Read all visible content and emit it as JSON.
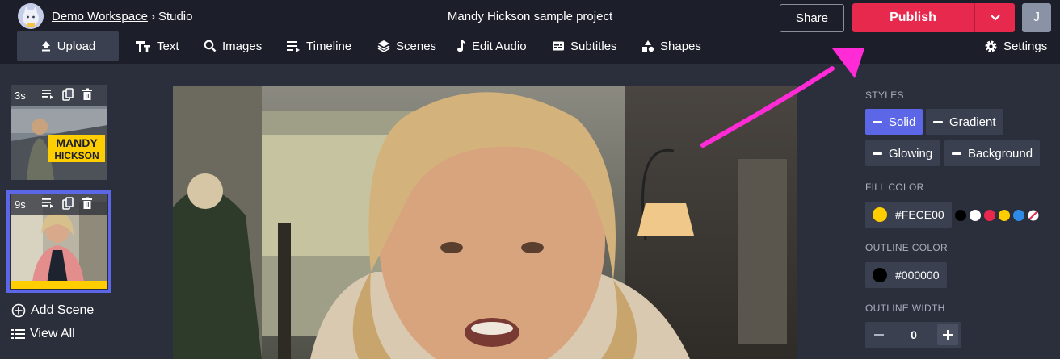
{
  "header": {
    "workspace": "Demo Workspace",
    "separator": "›",
    "section": "Studio",
    "project_title": "Mandy Hickson sample project",
    "share_label": "Share",
    "publish_label": "Publish",
    "user_initial": "J"
  },
  "toolbar": {
    "items": [
      {
        "label": "Upload",
        "icon": "upload-icon"
      },
      {
        "label": "Text",
        "icon": "text-icon"
      },
      {
        "label": "Images",
        "icon": "search-icon"
      },
      {
        "label": "Timeline",
        "icon": "timeline-icon"
      },
      {
        "label": "Scenes",
        "icon": "layers-icon"
      },
      {
        "label": "Edit Audio",
        "icon": "music-note-icon"
      },
      {
        "label": "Subtitles",
        "icon": "subtitles-icon"
      },
      {
        "label": "Shapes",
        "icon": "shapes-icon"
      }
    ],
    "settings_label": "Settings"
  },
  "scenes": {
    "items": [
      {
        "duration": "3s",
        "caption_line1": "MANDY",
        "caption_line2": "HICKSON"
      },
      {
        "duration": "9s"
      }
    ],
    "add_scene_label": "Add Scene",
    "view_all_label": "View All"
  },
  "properties": {
    "styles_label": "STYLES",
    "styles": [
      "Solid",
      "Gradient",
      "Glowing",
      "Background"
    ],
    "active_style": "Solid",
    "fill_color_label": "FILL COLOR",
    "fill_color": "#FECE00",
    "outline_color_label": "OUTLINE COLOR",
    "outline_color": "#000000",
    "outline_width_label": "OUTLINE WIDTH",
    "outline_width": "0",
    "preset_colors": [
      "#000000",
      "#ffffff",
      "#e8294e",
      "#fece00",
      "#2f8ae6",
      "none"
    ]
  },
  "colors": {
    "accent": "#5b67e6",
    "publish": "#e8294e",
    "annotation_arrow": "#ff2bd6"
  }
}
